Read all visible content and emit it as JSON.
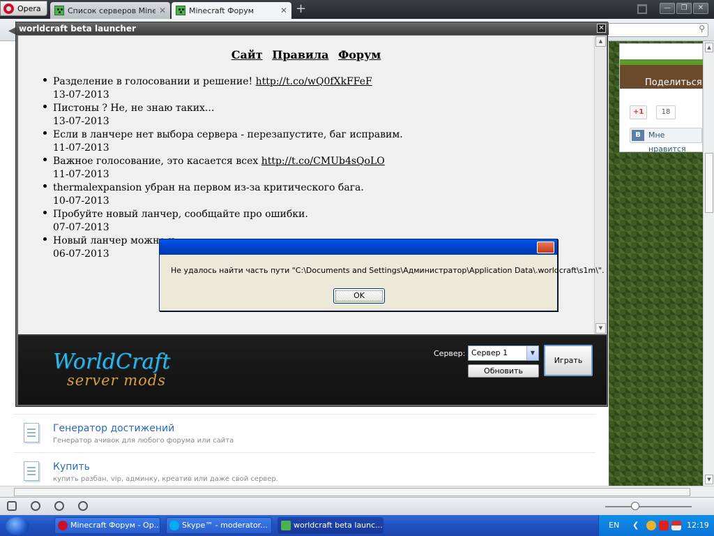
{
  "browser": {
    "menu_label": "Opera",
    "tabs": [
      {
        "label": "Список серверов Minecr..."
      },
      {
        "label": "Minecraft Форум"
      }
    ],
    "new_tab_glyph": "+",
    "close_glyph": "✕"
  },
  "page": {
    "share_label": "Поделиться",
    "gplus_label": "+1",
    "gplus_count": "18",
    "vk_label": "Мне нравится",
    "items": [
      {
        "title": "Генератор достижений",
        "desc": "Генератор ачивок для любого форума или сайта"
      },
      {
        "title": "Купить",
        "desc": "купить разбан, vip, админку, креатив или даже свой сервер."
      }
    ]
  },
  "launcher": {
    "title": "worldcraft beta launcher",
    "nav": [
      "Сайт",
      "Правила",
      "Форум"
    ],
    "news": [
      {
        "text": "Разделение в голосовании и решение! ",
        "link": "http://t.co/wQ0fXkFFeF",
        "date": "13-07-2013"
      },
      {
        "text": "Пистоны ? Не, не знаю таких...",
        "link": "",
        "date": "13-07-2013"
      },
      {
        "text": "Если в ланчере нет выбора сервера - перезапустите, баг исправим.",
        "link": "",
        "date": "11-07-2013"
      },
      {
        "text": "Важное голосование, это касается всех ",
        "link": "http://t.co/CMUb4sQoLO",
        "date": "11-07-2013"
      },
      {
        "text": "thermalexpansion убран на первом из-за критического бага.",
        "link": "",
        "date": "10-07-2013"
      },
      {
        "text": "Пробуйте новый ланчер, сообщайте про ошибки.",
        "link": "",
        "date": "07-07-2013"
      },
      {
        "text": "Новый ланчер можно н",
        "link": "",
        "date": "06-07-2013"
      }
    ],
    "logo_line1": "WorldCraft",
    "logo_line2": "server mods",
    "server_label": "Сервер:",
    "server_selected": "Сервер 1",
    "refresh_label": "Обновить",
    "play_label": "Играть"
  },
  "error_dialog": {
    "message": "Не удалось найти часть пути \"C:\\Documents and Settings\\Администратор\\Application Data\\.worldcraft\\s1m\\\".",
    "ok_label": "OK"
  },
  "taskbar": {
    "buttons": [
      {
        "label": "Minecraft Форум - Op..."
      },
      {
        "label": "Skype™ - moderator..."
      },
      {
        "label": "worldcraft beta launc..."
      }
    ],
    "lang": "EN",
    "clock": "12:19"
  },
  "colors": {
    "taskbar": "#2050c0",
    "accent_link": "#2a6ab8",
    "logo_blue": "#34b4e4",
    "logo_gold": "#d8a13a"
  }
}
